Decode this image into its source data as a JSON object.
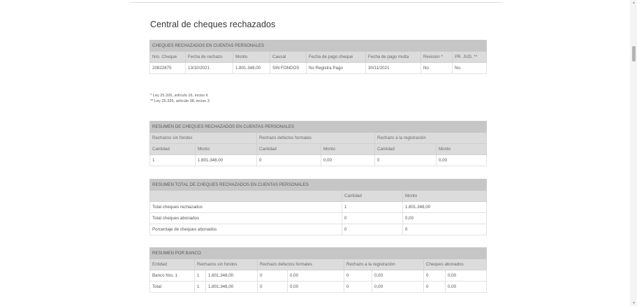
{
  "page": {
    "title": "Central de cheques rechazados"
  },
  "t1": {
    "caption": "CHEQUES RECHAZADOS EN CUENTAS PERSONALES",
    "headers": [
      "Nro. Cheque",
      "Fecha de rechazo",
      "Monto",
      "Causal",
      "Fecha de pago cheque",
      "Fecha de pago multa",
      "Revision *",
      "PR. JUD. **"
    ],
    "row": [
      "20822875",
      "13/10/2021",
      "1.801.348,00",
      "SIN FONDOS",
      "No Registra Pago",
      "30/11/2021",
      "No",
      "No"
    ]
  },
  "notes": [
    "* Ley 25.326, artículo 16, inciso 6",
    "** Ley 25.326, artículo 38, inciso 3"
  ],
  "t2": {
    "caption": "RESUMEN DE CHEQUES RECHAZADOS EN CUENTAS PERSONALES",
    "groups": [
      "Rechazos sin fondos",
      "Rechazo defectos formales",
      "Rechazo a la registración"
    ],
    "subheaders": [
      "Cantidad",
      "Monto",
      "Cantidad",
      "Monto",
      "Cantidad",
      "Monto"
    ],
    "row": [
      "1",
      "1.801.348,00",
      "0",
      "0,00",
      "0",
      "0,00"
    ]
  },
  "t3": {
    "caption": "RESUMEN TOTAL DE CHEQUES RECHAZADOS EN CUENTAS PERSONALES",
    "headers": [
      "",
      "Cantidad",
      "Monto"
    ],
    "rows": [
      [
        "Total cheques rechazados",
        "1",
        "1.801.348,00"
      ],
      [
        "Total cheques abonados",
        "0",
        "0,00"
      ],
      [
        "Porcentaje de cheques abonados",
        "0",
        "0"
      ]
    ]
  },
  "t4": {
    "caption": "RESUMEN POR BANCO",
    "headers": [
      "Entidad",
      "Rechazos sin fondos",
      "Rechazo defectos formales",
      "Rechazo a la registración",
      "Cheques abonados"
    ],
    "rows": [
      [
        "Banco Nro. 1",
        "1",
        "1.801.348,00",
        "0",
        "0,00",
        "0",
        "0,00",
        "0",
        "0,00"
      ],
      [
        "Total",
        "1",
        "1.801.348,00",
        "0",
        "0,00",
        "0",
        "0,00",
        "0",
        "0,00"
      ]
    ]
  }
}
